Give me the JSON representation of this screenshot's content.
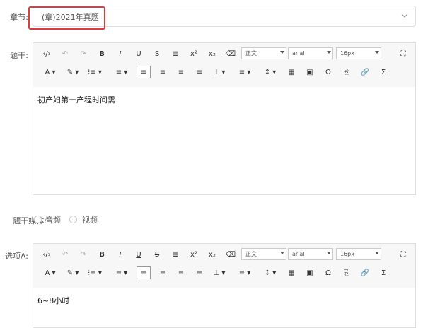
{
  "form": {
    "chapter": {
      "label": "章节:",
      "value": "(章)2021年真题"
    },
    "stem": {
      "label": "题干:",
      "content": "初产妇第一产程时间需"
    },
    "media": {
      "label": "题干媒体:",
      "options": [
        "音频",
        "视频"
      ]
    },
    "optionA": {
      "label": "选项A:",
      "content": "6~8小时"
    }
  },
  "toolbar": {
    "row1": [
      "‹/›",
      "↶",
      "↷",
      "B",
      "I",
      "U",
      "S",
      "≣",
      "x²",
      "x₂",
      "⌫"
    ],
    "format": {
      "block": "正文",
      "font": "arial",
      "size": "16px"
    },
    "fullscreen": "⛶",
    "row2": [
      "A ▾",
      "✎ ▾",
      "⁝≡ ▾",
      "≡ ▾",
      "≡",
      "≡",
      "≡",
      "≡",
      "⊥ ▾",
      "≡ ▾",
      "↕ ▾",
      "▦",
      "▣",
      "Ω",
      "⎘",
      "🔗",
      "Σ"
    ]
  },
  "colors": {
    "highlight": "#e03a3a",
    "border": "#dcdfe6",
    "toolbar_bg": "#f7f7f7"
  }
}
